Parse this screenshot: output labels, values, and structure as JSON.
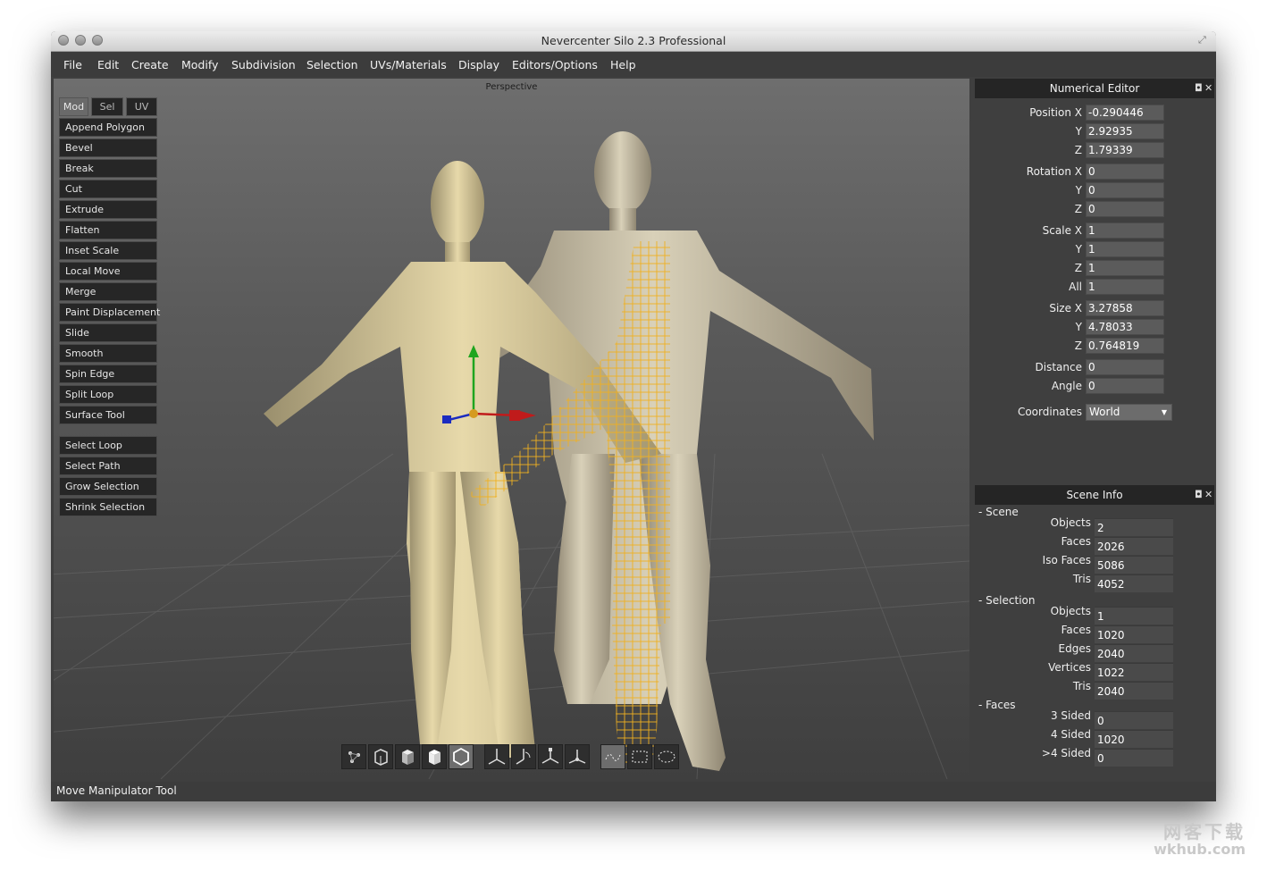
{
  "window": {
    "title": "Nevercenter Silo 2.3 Professional"
  },
  "menu": [
    "File",
    "Edit",
    "Create",
    "Modify",
    "Subdivision",
    "Selection",
    "UVs/Materials",
    "Display",
    "Editors/Options",
    "Help"
  ],
  "viewport": {
    "label": "Perspective"
  },
  "tool_tabs": [
    "Mod",
    "Sel",
    "UV"
  ],
  "tools": [
    "Append Polygon",
    "Bevel",
    "Break",
    "Cut",
    "Extrude",
    "Flatten",
    "Inset Scale",
    "Local Move",
    "Merge",
    "Paint Displacement",
    "Slide",
    "Smooth",
    "Spin Edge",
    "Split Loop",
    "Surface Tool"
  ],
  "selection_tools": [
    "Select Loop",
    "Select Path",
    "Grow Selection",
    "Shrink Selection"
  ],
  "toolbar_icons": [
    "vertex-mode-icon",
    "edge-mode-icon",
    "face-mode-icon",
    "object-mode-icon",
    "hexagon-icon",
    "move-axes-icon",
    "rotate-axes-icon",
    "scale-axes-icon",
    "manipulator-axes-icon",
    "lasso-icon",
    "rect-select-icon",
    "ellipse-select-icon"
  ],
  "status": "Move Manipulator Tool",
  "numerical_editor": {
    "title": "Numerical Editor",
    "position": {
      "label": "Position X",
      "x": "-0.290446",
      "y": "2.92935",
      "z": "1.79339"
    },
    "rotation": {
      "label": "Rotation X",
      "x": "0",
      "y": "0",
      "z": "0"
    },
    "scale": {
      "label": "Scale X",
      "x": "1",
      "y": "1",
      "z": "1",
      "all": "1"
    },
    "size": {
      "label": "Size X",
      "x": "3.27858",
      "y": "4.78033",
      "z": "0.764819"
    },
    "distance": {
      "label": "Distance",
      "value": "0"
    },
    "angle": {
      "label": "Angle",
      "value": "0"
    },
    "coordinates": {
      "label": "Coordinates",
      "value": "World"
    },
    "axis_labels": {
      "y": "Y",
      "z": "Z",
      "all": "All"
    }
  },
  "scene_info": {
    "title": "Scene Info",
    "scene": {
      "label": "Scene",
      "rows": [
        {
          "k": "Objects",
          "v": "2"
        },
        {
          "k": "Faces",
          "v": "2026"
        },
        {
          "k": "Iso Faces",
          "v": "5086"
        },
        {
          "k": "Tris",
          "v": "4052"
        }
      ]
    },
    "selection": {
      "label": "Selection",
      "rows": [
        {
          "k": "Objects",
          "v": "1"
        },
        {
          "k": "Faces",
          "v": "1020"
        },
        {
          "k": "Edges",
          "v": "2040"
        },
        {
          "k": "Vertices",
          "v": "1022"
        },
        {
          "k": "Tris",
          "v": "2040"
        }
      ]
    },
    "faces": {
      "label": "Faces",
      "rows": [
        {
          "k": "3 Sided",
          "v": "0"
        },
        {
          "k": "4 Sided",
          "v": "1020"
        },
        {
          "k": ">4 Sided",
          "v": "0"
        }
      ]
    }
  },
  "watermark": {
    "line1": "网客下载",
    "line2": "wkhub.com"
  }
}
